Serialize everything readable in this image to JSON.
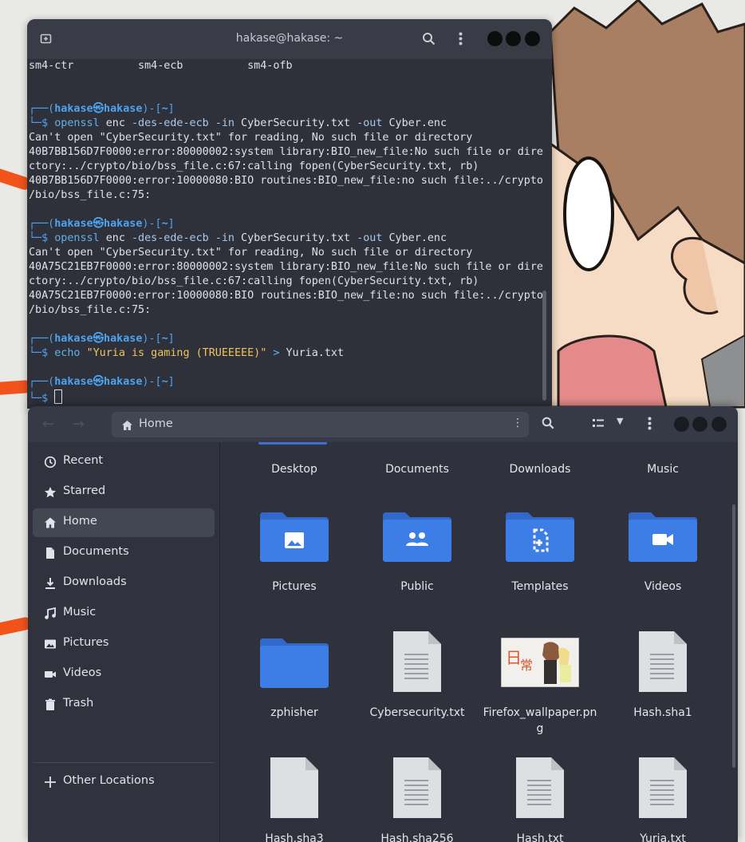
{
  "terminal": {
    "title": "hakase@hakase: ~",
    "lines": [
      {
        "type": "text",
        "text": "sm4-ctr          sm4-ecb          sm4-ofb"
      },
      {
        "type": "blank"
      },
      {
        "type": "blank"
      },
      {
        "type": "prompt",
        "user": "hakase",
        "at": "㉿",
        "host": "hakase",
        "dir": "~"
      },
      {
        "type": "cmd",
        "parts": [
          [
            "$ ",
            "brk"
          ],
          [
            "openssl",
            "cmd"
          ],
          [
            " enc ",
            "txt"
          ],
          [
            "-des-ede-ecb",
            "opt"
          ],
          [
            " ",
            "txt"
          ],
          [
            "-in",
            "opt"
          ],
          [
            " CyberSecurity.txt ",
            "txt"
          ],
          [
            "-out",
            "opt"
          ],
          [
            " Cyber.enc",
            "txt"
          ]
        ]
      },
      {
        "type": "text",
        "text": "Can't open \"CyberSecurity.txt\" for reading, No such file or directory"
      },
      {
        "type": "text",
        "text": "40B7BB156D7F0000:error:80000002:system library:BIO_new_file:No such file or dire"
      },
      {
        "type": "text",
        "text": "ctory:../crypto/bio/bss_file.c:67:calling fopen(CyberSecurity.txt, rb)"
      },
      {
        "type": "text",
        "text": "40B7BB156D7F0000:error:10000080:BIO routines:BIO_new_file:no such file:../crypto"
      },
      {
        "type": "text",
        "text": "/bio/bss_file.c:75:"
      },
      {
        "type": "blank"
      },
      {
        "type": "prompt",
        "user": "hakase",
        "at": "㉿",
        "host": "hakase",
        "dir": "~"
      },
      {
        "type": "cmd",
        "parts": [
          [
            "$ ",
            "brk"
          ],
          [
            "openssl",
            "cmd"
          ],
          [
            " enc ",
            "txt"
          ],
          [
            "-des-ede-ecb",
            "opt"
          ],
          [
            " ",
            "txt"
          ],
          [
            "-in",
            "opt"
          ],
          [
            " CyberSecurity.txt ",
            "txt"
          ],
          [
            "-out",
            "opt"
          ],
          [
            " Cyber.enc",
            "txt"
          ]
        ]
      },
      {
        "type": "text",
        "text": "Can't open \"CyberSecurity.txt\" for reading, No such file or directory"
      },
      {
        "type": "text",
        "text": "40A75C21EB7F0000:error:80000002:system library:BIO_new_file:No such file or dire"
      },
      {
        "type": "text",
        "text": "ctory:../crypto/bio/bss_file.c:67:calling fopen(CyberSecurity.txt, rb)"
      },
      {
        "type": "text",
        "text": "40A75C21EB7F0000:error:10000080:BIO routines:BIO_new_file:no such file:../crypto"
      },
      {
        "type": "text",
        "text": "/bio/bss_file.c:75:"
      },
      {
        "type": "blank"
      },
      {
        "type": "prompt",
        "user": "hakase",
        "at": "㉿",
        "host": "hakase",
        "dir": "~"
      },
      {
        "type": "cmd",
        "parts": [
          [
            "$ ",
            "brk"
          ],
          [
            "echo",
            "cmd"
          ],
          [
            " ",
            "txt"
          ],
          [
            "\"Yuria is gaming (TRUEEEEE)\"",
            "str"
          ],
          [
            " ",
            "txt"
          ],
          [
            ">",
            "op"
          ],
          [
            " Yuria.txt",
            "txt"
          ]
        ]
      },
      {
        "type": "blank"
      },
      {
        "type": "prompt",
        "user": "hakase",
        "at": "㉿",
        "host": "hakase",
        "dir": "~"
      },
      {
        "type": "cursorline",
        "parts": [
          [
            "$ ",
            "brk"
          ]
        ]
      }
    ]
  },
  "files": {
    "path_label": "Home",
    "sidebar": [
      {
        "label": "Recent",
        "icon": "clock-icon"
      },
      {
        "label": "Starred",
        "icon": "star-icon"
      },
      {
        "label": "Home",
        "icon": "home-icon",
        "active": true
      },
      {
        "label": "Documents",
        "icon": "document-icon"
      },
      {
        "label": "Downloads",
        "icon": "download-icon"
      },
      {
        "label": "Music",
        "icon": "music-icon"
      },
      {
        "label": "Pictures",
        "icon": "picture-icon"
      },
      {
        "label": "Videos",
        "icon": "video-icon"
      },
      {
        "label": "Trash",
        "icon": "trash-icon"
      }
    ],
    "other_locations": "Other Locations",
    "top_row": [
      "Desktop",
      "Documents",
      "Downloads",
      "Music"
    ],
    "items": [
      {
        "label": "Pictures",
        "kind": "folder",
        "emblem": "picture"
      },
      {
        "label": "Public",
        "kind": "folder",
        "emblem": "people"
      },
      {
        "label": "Templates",
        "kind": "folder",
        "emblem": "template"
      },
      {
        "label": "Videos",
        "kind": "folder",
        "emblem": "video"
      },
      {
        "label": "zphisher",
        "kind": "folder",
        "emblem": "none"
      },
      {
        "label": "Cybersecurity.txt",
        "kind": "text"
      },
      {
        "label": "Firefox_wallpaper.png",
        "kind": "image"
      },
      {
        "label": "Hash.sha1",
        "kind": "text"
      },
      {
        "label": "Hash.sha3",
        "kind": "blank"
      },
      {
        "label": "Hash.sha256",
        "kind": "text"
      },
      {
        "label": "Hash.txt",
        "kind": "text"
      },
      {
        "label": "Yuria.txt",
        "kind": "text"
      }
    ]
  },
  "colors": {
    "folder": "#3d7ee6",
    "folder_back": "#3168c9",
    "terminal_bg": "#2e3139",
    "files_bg": "#2f323c",
    "accent": "#4ea3f0",
    "swoosh": "#f2531b"
  },
  "wallpaper": {
    "watermark": "nichijou"
  }
}
